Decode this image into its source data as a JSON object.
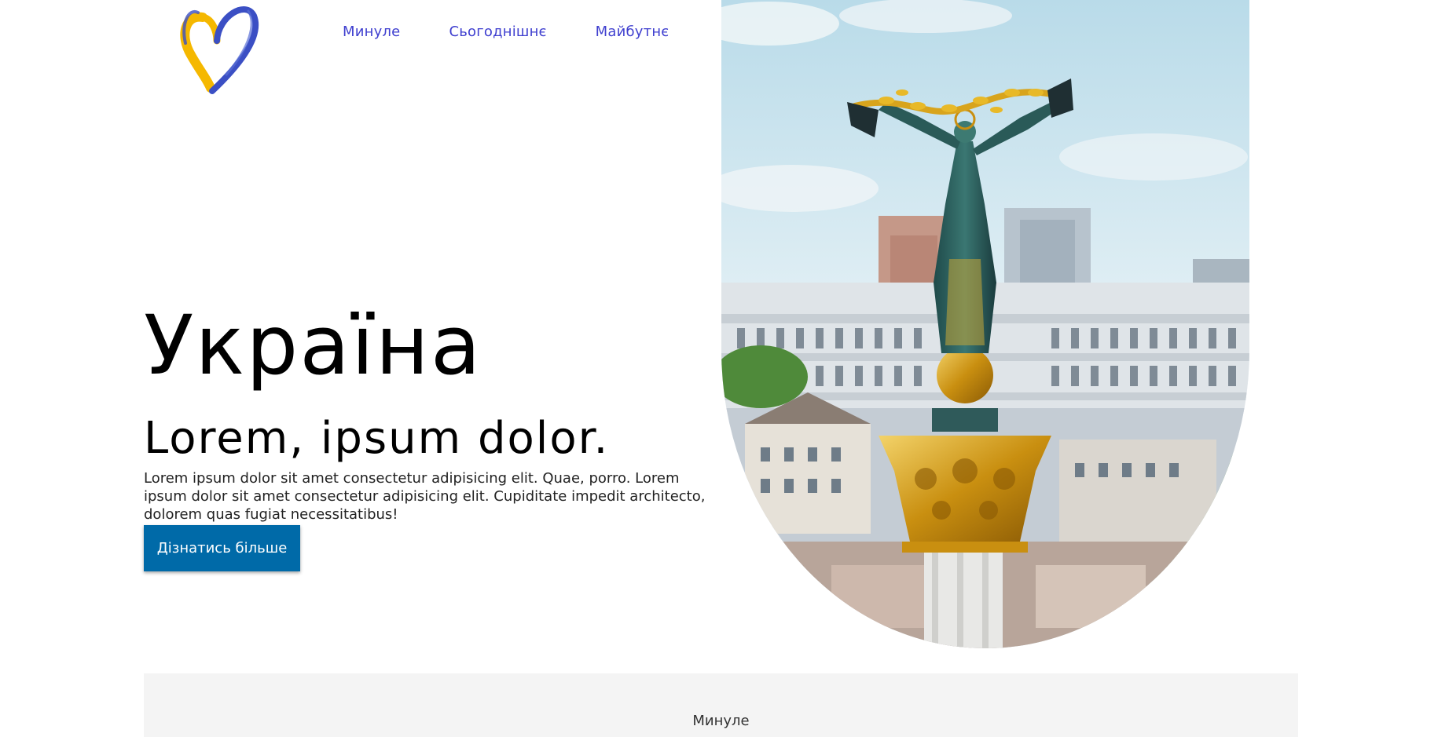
{
  "header": {
    "logo_name": "heart-logo",
    "nav": [
      {
        "label": "Минуле"
      },
      {
        "label": "Сьогоднішнє"
      },
      {
        "label": "Майбутнє"
      }
    ]
  },
  "hero": {
    "title": "Україна",
    "subtitle": "Lorem, ipsum dolor.",
    "text": "Lorem ipsum dolor sit amet consectetur adipisicing elit. Quae, porro. Lorem ipsum dolor sit amet consectetur adipisicing elit. Cupiditate impedit architecto, dolorem quas fugiat necessitatibus!",
    "cta_label": "Дізнатись більше",
    "image_subject": "independence-monument-kyiv"
  },
  "section": {
    "label": "Минуле"
  },
  "colors": {
    "nav_link": "#3f3fcf",
    "cta_bg": "#006aa8",
    "section_bg": "#f4f4f4",
    "heart_blue": "#3b4fc4",
    "heart_yellow": "#f5b800"
  }
}
